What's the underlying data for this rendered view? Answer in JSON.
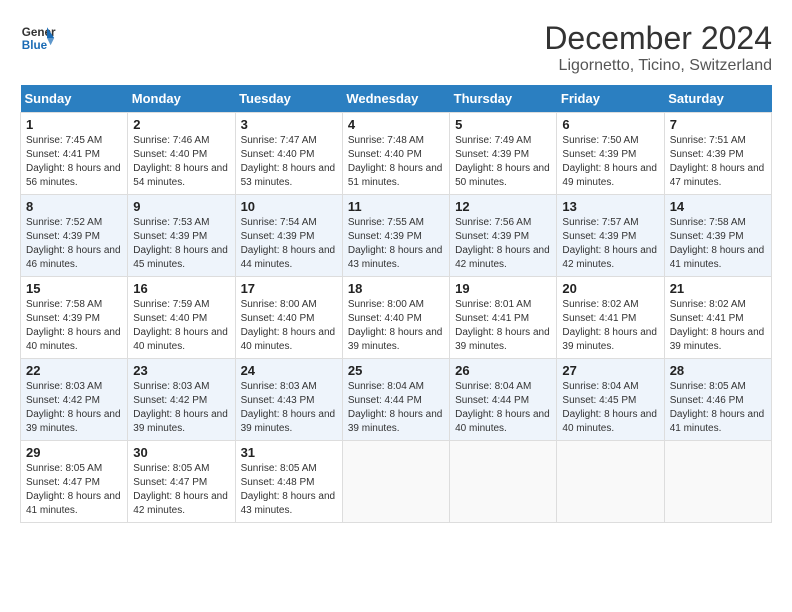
{
  "header": {
    "logo_line1": "General",
    "logo_line2": "Blue",
    "month": "December 2024",
    "location": "Ligornetto, Ticino, Switzerland"
  },
  "weekdays": [
    "Sunday",
    "Monday",
    "Tuesday",
    "Wednesday",
    "Thursday",
    "Friday",
    "Saturday"
  ],
  "weeks": [
    [
      {
        "day": "1",
        "sunrise": "7:45 AM",
        "sunset": "4:41 PM",
        "daylight": "8 hours and 56 minutes."
      },
      {
        "day": "2",
        "sunrise": "7:46 AM",
        "sunset": "4:40 PM",
        "daylight": "8 hours and 54 minutes."
      },
      {
        "day": "3",
        "sunrise": "7:47 AM",
        "sunset": "4:40 PM",
        "daylight": "8 hours and 53 minutes."
      },
      {
        "day": "4",
        "sunrise": "7:48 AM",
        "sunset": "4:40 PM",
        "daylight": "8 hours and 51 minutes."
      },
      {
        "day": "5",
        "sunrise": "7:49 AM",
        "sunset": "4:39 PM",
        "daylight": "8 hours and 50 minutes."
      },
      {
        "day": "6",
        "sunrise": "7:50 AM",
        "sunset": "4:39 PM",
        "daylight": "8 hours and 49 minutes."
      },
      {
        "day": "7",
        "sunrise": "7:51 AM",
        "sunset": "4:39 PM",
        "daylight": "8 hours and 47 minutes."
      }
    ],
    [
      {
        "day": "8",
        "sunrise": "7:52 AM",
        "sunset": "4:39 PM",
        "daylight": "8 hours and 46 minutes."
      },
      {
        "day": "9",
        "sunrise": "7:53 AM",
        "sunset": "4:39 PM",
        "daylight": "8 hours and 45 minutes."
      },
      {
        "day": "10",
        "sunrise": "7:54 AM",
        "sunset": "4:39 PM",
        "daylight": "8 hours and 44 minutes."
      },
      {
        "day": "11",
        "sunrise": "7:55 AM",
        "sunset": "4:39 PM",
        "daylight": "8 hours and 43 minutes."
      },
      {
        "day": "12",
        "sunrise": "7:56 AM",
        "sunset": "4:39 PM",
        "daylight": "8 hours and 42 minutes."
      },
      {
        "day": "13",
        "sunrise": "7:57 AM",
        "sunset": "4:39 PM",
        "daylight": "8 hours and 42 minutes."
      },
      {
        "day": "14",
        "sunrise": "7:58 AM",
        "sunset": "4:39 PM",
        "daylight": "8 hours and 41 minutes."
      }
    ],
    [
      {
        "day": "15",
        "sunrise": "7:58 AM",
        "sunset": "4:39 PM",
        "daylight": "8 hours and 40 minutes."
      },
      {
        "day": "16",
        "sunrise": "7:59 AM",
        "sunset": "4:40 PM",
        "daylight": "8 hours and 40 minutes."
      },
      {
        "day": "17",
        "sunrise": "8:00 AM",
        "sunset": "4:40 PM",
        "daylight": "8 hours and 40 minutes."
      },
      {
        "day": "18",
        "sunrise": "8:00 AM",
        "sunset": "4:40 PM",
        "daylight": "8 hours and 39 minutes."
      },
      {
        "day": "19",
        "sunrise": "8:01 AM",
        "sunset": "4:41 PM",
        "daylight": "8 hours and 39 minutes."
      },
      {
        "day": "20",
        "sunrise": "8:02 AM",
        "sunset": "4:41 PM",
        "daylight": "8 hours and 39 minutes."
      },
      {
        "day": "21",
        "sunrise": "8:02 AM",
        "sunset": "4:41 PM",
        "daylight": "8 hours and 39 minutes."
      }
    ],
    [
      {
        "day": "22",
        "sunrise": "8:03 AM",
        "sunset": "4:42 PM",
        "daylight": "8 hours and 39 minutes."
      },
      {
        "day": "23",
        "sunrise": "8:03 AM",
        "sunset": "4:42 PM",
        "daylight": "8 hours and 39 minutes."
      },
      {
        "day": "24",
        "sunrise": "8:03 AM",
        "sunset": "4:43 PM",
        "daylight": "8 hours and 39 minutes."
      },
      {
        "day": "25",
        "sunrise": "8:04 AM",
        "sunset": "4:44 PM",
        "daylight": "8 hours and 39 minutes."
      },
      {
        "day": "26",
        "sunrise": "8:04 AM",
        "sunset": "4:44 PM",
        "daylight": "8 hours and 40 minutes."
      },
      {
        "day": "27",
        "sunrise": "8:04 AM",
        "sunset": "4:45 PM",
        "daylight": "8 hours and 40 minutes."
      },
      {
        "day": "28",
        "sunrise": "8:05 AM",
        "sunset": "4:46 PM",
        "daylight": "8 hours and 41 minutes."
      }
    ],
    [
      {
        "day": "29",
        "sunrise": "8:05 AM",
        "sunset": "4:47 PM",
        "daylight": "8 hours and 41 minutes."
      },
      {
        "day": "30",
        "sunrise": "8:05 AM",
        "sunset": "4:47 PM",
        "daylight": "8 hours and 42 minutes."
      },
      {
        "day": "31",
        "sunrise": "8:05 AM",
        "sunset": "4:48 PM",
        "daylight": "8 hours and 43 minutes."
      },
      null,
      null,
      null,
      null
    ]
  ]
}
